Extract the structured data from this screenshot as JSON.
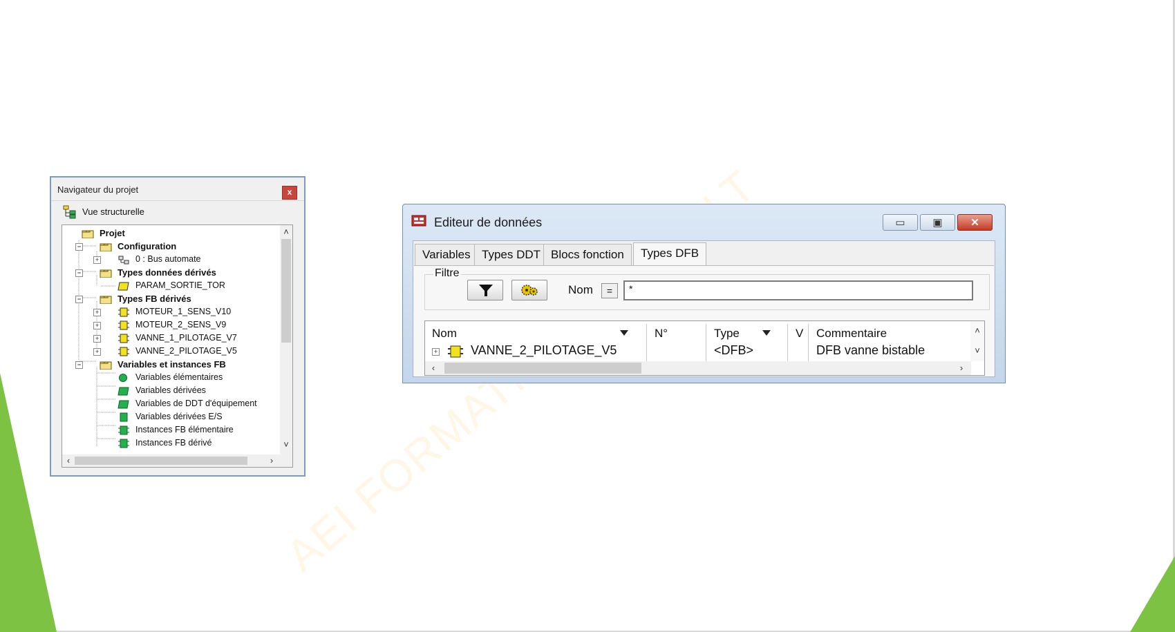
{
  "navigator": {
    "title": "Navigateur du projet",
    "close_glyph": "x",
    "view_label": "Vue structurelle",
    "tree": [
      {
        "label": "Projet",
        "bold": true,
        "expander": "",
        "icon": "folder-open-icon"
      },
      {
        "label": "Configuration",
        "bold": true,
        "expander": "−",
        "icon": "folder-open-icon"
      },
      {
        "label": "0 : Bus automate",
        "bold": false,
        "expander": "+",
        "icon": "bus-icon"
      },
      {
        "label": "Types données dérivés",
        "bold": true,
        "expander": "−",
        "icon": "folder-open-icon"
      },
      {
        "label": "PARAM_SORTIE_TOR",
        "bold": false,
        "expander": "",
        "icon": "ddt-icon"
      },
      {
        "label": "Types FB dérivés",
        "bold": true,
        "expander": "−",
        "icon": "folder-open-icon"
      },
      {
        "label": "MOTEUR_1_SENS_V10",
        "bold": false,
        "expander": "+",
        "icon": "fb-icon"
      },
      {
        "label": "MOTEUR_2_SENS_V9",
        "bold": false,
        "expander": "+",
        "icon": "fb-icon"
      },
      {
        "label": "VANNE_1_PILOTAGE_V7",
        "bold": false,
        "expander": "+",
        "icon": "fb-icon"
      },
      {
        "label": "VANNE_2_PILOTAGE_V5",
        "bold": false,
        "expander": "+",
        "icon": "fb-icon"
      },
      {
        "label": "Variables et instances FB",
        "bold": true,
        "expander": "−",
        "icon": "folder-open-icon"
      },
      {
        "label": "Variables élémentaires",
        "bold": false,
        "expander": "",
        "icon": "green-dot-icon"
      },
      {
        "label": "Variables dérivées",
        "bold": false,
        "expander": "",
        "icon": "green-ddt-icon"
      },
      {
        "label": "Variables de DDT d'équipement",
        "bold": false,
        "expander": "",
        "icon": "green-ddt-icon"
      },
      {
        "label": "Variables dérivées E/S",
        "bold": false,
        "expander": "",
        "icon": "green-io-icon"
      },
      {
        "label": "Instances FB élémentaire",
        "bold": false,
        "expander": "",
        "icon": "green-fb-icon"
      },
      {
        "label": "Instances FB dérivé",
        "bold": false,
        "expander": "",
        "icon": "green-fb-icon"
      }
    ]
  },
  "editor": {
    "title": "Editeur de données",
    "tabs": [
      "Variables",
      "Types DDT",
      "Blocs fonction",
      "Types DFB"
    ],
    "active_tab": "Types DFB",
    "filter": {
      "legend": "Filtre",
      "nom_label": "Nom",
      "eq_label": "=",
      "value": "*"
    },
    "columns": [
      "Nom",
      "N°",
      "Type",
      "V",
      "Commentaire"
    ],
    "rows": [
      {
        "nom": "VANNE_2_PILOTAGE_V5",
        "numero": "",
        "type": "<DFB>",
        "v": "",
        "commentaire": "DFB vanne bistable"
      }
    ]
  },
  "watermark": {
    "text": "AEI    FORMATION    CONSULT"
  },
  "colors": {
    "accent_green": "#7dc242",
    "tree_fb_yellow": "#f2e21e",
    "tree_green": "#22b14c",
    "close_red": "#c43b26"
  }
}
